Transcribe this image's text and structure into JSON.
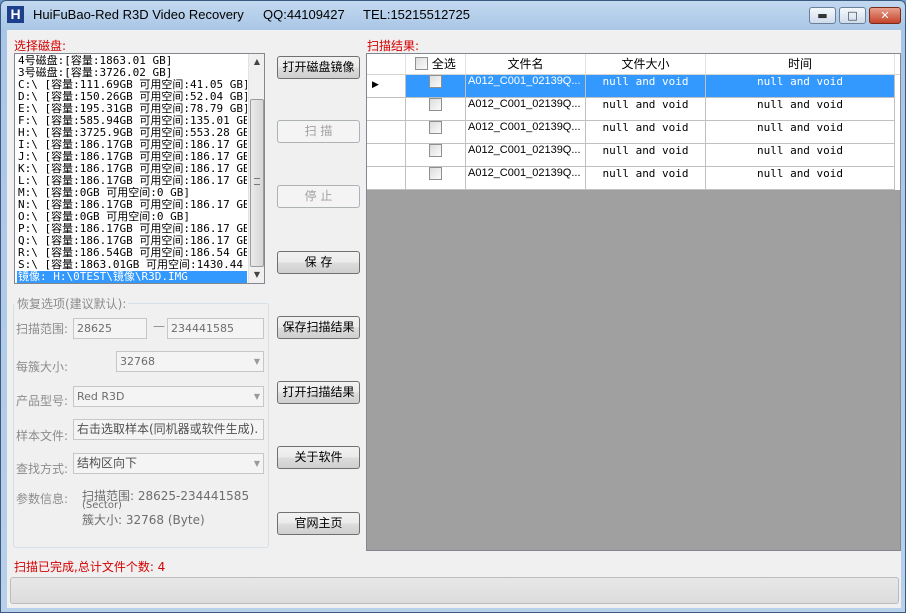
{
  "window": {
    "app_name": "HuiFuBao-Red R3D Video Recovery",
    "qq": "QQ:44109427",
    "tel": "TEL:15215512725",
    "minimize": "▬",
    "maximize": "□",
    "close": "✕"
  },
  "left": {
    "disk_label": "选择磁盘:",
    "disks": [
      "4号磁盘:[容量:1863.01 GB]",
      "3号磁盘:[容量:3726.02 GB]",
      "C:\\ [容量:111.69GB 可用空间:41.05 GB]",
      "D:\\ [容量:150.26GB 可用空间:52.04 GB]",
      "E:\\ [容量:195.31GB 可用空间:78.79 GB]",
      "F:\\ [容量:585.94GB 可用空间:135.01 GB]",
      "H:\\ [容量:3725.9GB 可用空间:553.28 GB]",
      "I:\\ [容量:186.17GB 可用空间:186.17 GB]",
      "J:\\ [容量:186.17GB 可用空间:186.17 GB]",
      "K:\\ [容量:186.17GB 可用空间:186.17 GB]",
      "L:\\ [容量:186.17GB 可用空间:186.17 GB]",
      "M:\\ [容量:0GB 可用空间:0 GB]",
      "N:\\ [容量:186.17GB 可用空间:186.17 GB]",
      "O:\\ [容量:0GB 可用空间:0 GB]",
      "P:\\ [容量:186.17GB 可用空间:186.17 GB]",
      "Q:\\ [容量:186.17GB 可用空间:186.17 GB]",
      "R:\\ [容量:186.54GB 可用空间:186.54 GB]",
      "S:\\ [容量:1863.01GB 可用空间:1430.44",
      "镜像: H:\\0TEST\\镜像\\R3D.IMG"
    ],
    "options_title": "恢复选项(建议默认):",
    "scan_range_label": "扫描范围:",
    "scan_range_start": "28625",
    "scan_range_end": "234441585",
    "dash": "—",
    "cluster_label": "每簇大小:",
    "cluster_value": "32768",
    "product_label": "产品型号:",
    "product_value": "Red R3D",
    "sample_label": "样本文件:",
    "sample_value": "右击选取样本(同机器或软件生成).",
    "find_label": "查找方式:",
    "find_value": "结构区向下",
    "param_label": "参数信息:",
    "param_range": "扫描范围: 28625-234441585",
    "param_sector": "(Sector)",
    "param_cluster": "簇大小: 32768 (Byte)"
  },
  "buttons": {
    "open_image": "打开磁盘镜像",
    "scan": "扫  描",
    "stop": "停  止",
    "save": "保  存",
    "save_scan": "保存扫描结果",
    "open_scan": "打开扫描结果",
    "about": "关于软件",
    "website": "官网主页"
  },
  "results": {
    "label": "扫描结果:",
    "columns": {
      "select_all": "全选",
      "filename": "文件名",
      "filesize": "文件大小",
      "time": "时间"
    },
    "rows": [
      {
        "name": "A012_C001_02139Q...",
        "size": "null and void",
        "time": "null and void"
      },
      {
        "name": "A012_C001_02139Q...",
        "size": "null and void",
        "time": "null and void"
      },
      {
        "name": "A012_C001_02139Q...",
        "size": "null and void",
        "time": "null and void"
      },
      {
        "name": "A012_C001_02139Q...",
        "size": "null and void",
        "time": "null and void"
      },
      {
        "name": "A012_C001_02139Q...",
        "size": "null and void",
        "time": "null and void"
      }
    ]
  },
  "status": {
    "text": "扫描已完成,总计文件个数: 4"
  }
}
